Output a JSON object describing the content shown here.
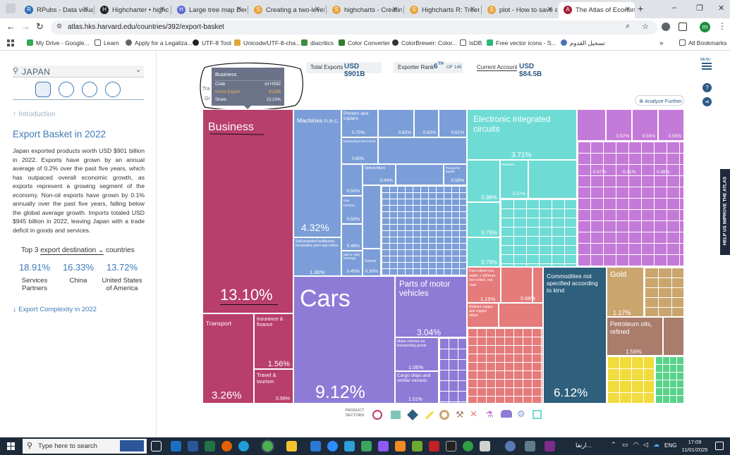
{
  "browser": {
    "tabs": [
      {
        "label": "RPubs - Data visuali",
        "color": "#2e6db4",
        "glyph": "R"
      },
      {
        "label": "Highcharter • highch",
        "color": "#222222",
        "glyph": "H"
      },
      {
        "label": "Large tree map Dem",
        "color": "#5b6ad8",
        "glyph": "H"
      },
      {
        "label": "Creating a two-level",
        "color": "#e8a33a",
        "glyph": "S"
      },
      {
        "label": "highcharts - Creatin",
        "color": "#e8a33a",
        "glyph": "S"
      },
      {
        "label": "Highcharts R: Treem",
        "color": "#e8a33a",
        "glyph": "S"
      },
      {
        "label": "plot - How to save a",
        "color": "#e8a33a",
        "glyph": "S"
      },
      {
        "label": "The Atlas of Econon",
        "color": "#a41e34",
        "glyph": "A"
      }
    ],
    "new_tab": "+",
    "window_controls": [
      "–",
      "❐",
      "✕"
    ],
    "url": "atlas.hks.harvard.edu/countries/392/export-basket",
    "profile_initial": "m",
    "bookmarks": [
      "My Drive - Google...",
      "Learn",
      "Apply for a Legaliza...",
      "UTF-8 Tool",
      "Unicode/UTF-8-cha...",
      "diacritics",
      "Color Converter",
      "ColorBrewer: Color...",
      "IsDB",
      "Free vector icons - S...",
      "تسجيل القدوم"
    ],
    "all_bookmarks": "All Bookmarks"
  },
  "sidebar": {
    "country": "JAPAN",
    "intro_link": "Introduction",
    "section_title": "Export Basket in 2022",
    "paragraph": "Japan exported products worth USD $901 billion in 2022. Exports have grown by an annual average of 0.2% over the past five years, which has outpaced overall economic growth, as exports represent a growing segment of the economy. Non-oil exports have grown by 0.1% annually over the past five years, falling below the global average growth. Imports totaled USD $945 billion in 2022, leaving Japan with a trade deficit in goods and services.",
    "top3_prefix": "Top 3",
    "top3_select": "export destination",
    "top3_suffix": "countries",
    "partners": [
      {
        "pct": "18.91%",
        "name": "Services Partners"
      },
      {
        "pct": "16.33%",
        "name": "China"
      },
      {
        "pct": "13.72%",
        "name": "United States of America"
      }
    ],
    "next_link": "Export Complexity in 2022"
  },
  "header": {
    "total_exports_label": "Total Exports",
    "total_exports_value": "USD $901B",
    "export_rank_label": "Exporter Rank",
    "export_rank_value": "6",
    "export_rank_sup": "TH",
    "export_rank_of": "OF 145",
    "current_account_label": "Current Account",
    "current_account_value": "USD $84.5B",
    "menu_label": "MENU"
  },
  "tooltip": {
    "title": "Business",
    "rows": [
      {
        "k": "Code",
        "v": "ict HS92"
      },
      {
        "k": "Gross Export",
        "v": "$118B"
      },
      {
        "k": "Share",
        "v": "13.10%"
      }
    ],
    "peek_left": "Tra",
    "peek_left2": "Gr"
  },
  "analyze_button": "Analyze Further",
  "side_tab": "HELP US IMPROVE THE ATLAS",
  "treemap": {
    "business": {
      "label": "Business",
      "pct": "13.10%"
    },
    "transport": {
      "label": "Transport",
      "pct": "3.26%"
    },
    "insurance": {
      "label": "Insurance & finance",
      "pct": "1.56%"
    },
    "travel": {
      "label": "Travel & tourism",
      "pct": "0.99%"
    },
    "machines": {
      "label": "Machines n.e.c.",
      "pct": "4.32%"
    },
    "printers": {
      "label": "Printers and copiers",
      "pct": "0.75%"
    },
    "measuring": {
      "label": "Measuring instruments",
      "pct": "0.80%"
    },
    "optical": {
      "label": "Optical fibers",
      "pct": "0.44%"
    },
    "pumps": {
      "label": "Pumps for liquids",
      "pct": "0.59%"
    },
    "gas_turbines": {
      "label": "Gas turbines",
      "pct": "0.50%"
    },
    "bulldozers": {
      "label": "Self-propelled bulldozers, excavators and road rollers",
      "pct": "1.30%"
    },
    "ballbearings": {
      "label": "Ball or roller bearings",
      "pct": "0.45%"
    },
    "games": {
      "label": "Games",
      "pct": "0.30%"
    },
    "electronic": {
      "label": "Electronic integrated circuits",
      "pct": "3.71%"
    },
    "batteries": {
      "label": "Batteries",
      "pct": "0.57%"
    },
    "cars": {
      "label": "Cars",
      "pct": "9.12%"
    },
    "parts": {
      "label": "Parts of motor vehicles",
      "pct": "3.04%"
    },
    "motor_vehicles": {
      "label": "Motor vehicles for transporting goods",
      "pct": "1.06%"
    },
    "cargo_ships": {
      "label": "Cargo ships and similar vessels",
      "pct": "1.01%"
    },
    "flat_iron": {
      "label": "Flat-rolled iron, width > 600mm, hot-rolled, not clad",
      "pct": "1.19%"
    },
    "refined_copper": {
      "label": "Refined copper and copper alloys",
      "pct": "0.68%"
    },
    "commodities": {
      "label": "Commodities not specified according to kind",
      "pct": "6.12%"
    },
    "gold": {
      "label": "Gold",
      "pct": "1.17%"
    },
    "petroleum": {
      "label": "Petroleum oils, refined",
      "pct": "1.56%"
    },
    "small_pcts": [
      "0.62%",
      "0.62%",
      "0.61%",
      "0.57%",
      "0.55%",
      "0.55%",
      "0.98%",
      "0.78%",
      "0.78%",
      "0.50%",
      "0.48%",
      "0.47%",
      "0.41%",
      "0.36%"
    ]
  },
  "product_sectors_label": "PRODUCT SECTORS",
  "sector_icons": [
    "services-icon",
    "textiles-icon",
    "agriculture-icon",
    "stone-icon",
    "minerals-icon",
    "metals-icon",
    "chemicals-icon",
    "vehicles-icon",
    "machinery-icon",
    "electronics-icon",
    "other-icon"
  ],
  "taskbar": {
    "search_placeholder": "Type here to search",
    "time": "17:09",
    "date": "11/01/2025",
    "lang": "ENG",
    "arabic_label": "ارتفا..."
  },
  "colors": {
    "services": "#b83e6b",
    "machinery": "#7b9ed8",
    "electronics": "#6edcd4",
    "vehicles": "#8e7bd6",
    "metals": "#e57b7b",
    "chemicals": "#c47ad8",
    "other": "#2e5f7c",
    "minerals": "#caa56d",
    "stone": "#f2dc3d",
    "agriculture": "#58d38b",
    "textiles": "#7ec6b8"
  }
}
